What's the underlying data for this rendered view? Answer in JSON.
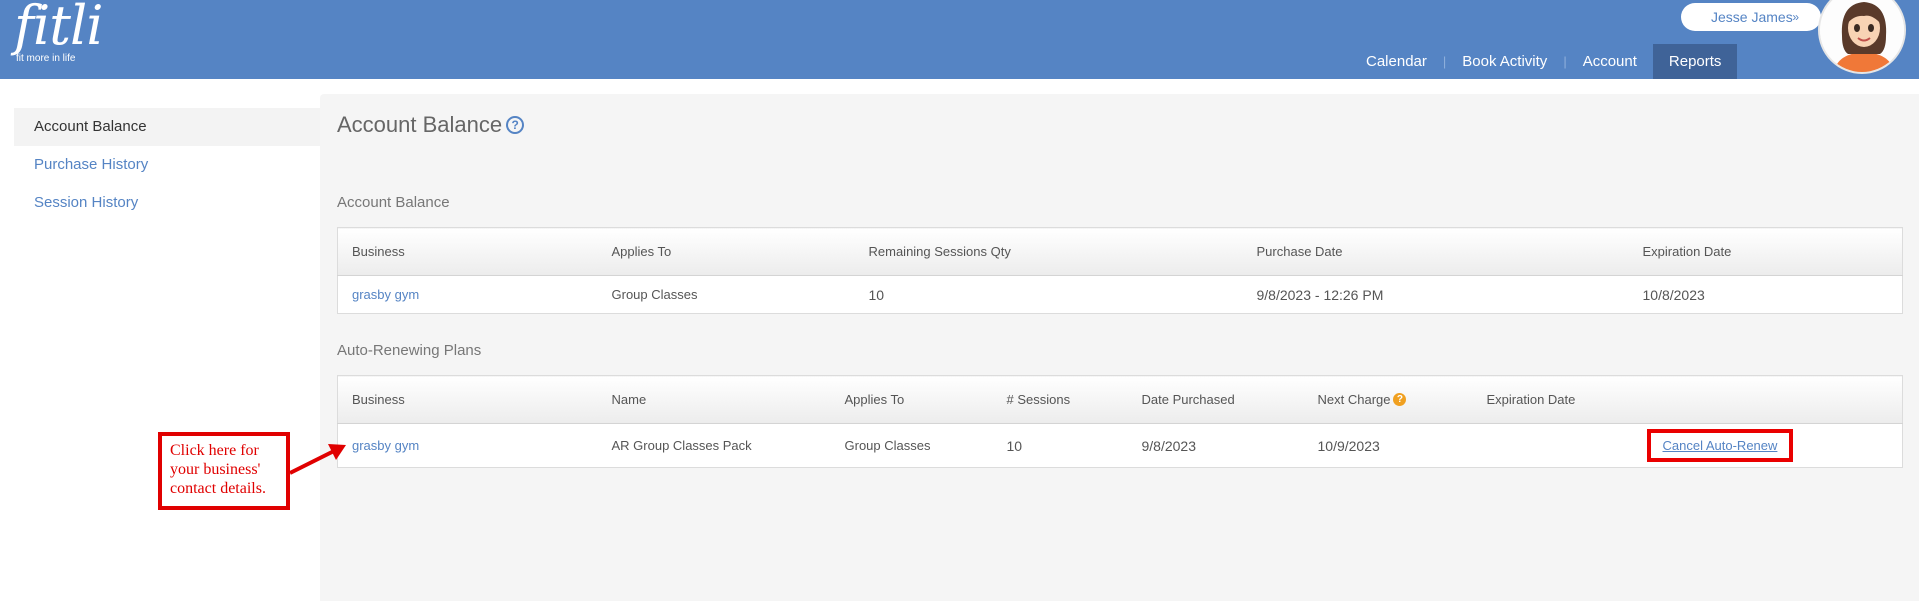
{
  "header": {
    "logo": "fitli",
    "tagline": "fit more in life",
    "user_name": "Jesse James",
    "user_chevron": "»",
    "nav": [
      {
        "label": "Calendar",
        "active": false
      },
      {
        "label": "Book Activity",
        "active": false
      },
      {
        "label": "Account",
        "active": false
      },
      {
        "label": "Reports",
        "active": true
      }
    ]
  },
  "sidebar": {
    "items": [
      {
        "label": "Account Balance",
        "active": true
      },
      {
        "label": "Purchase History",
        "active": false
      },
      {
        "label": "Session History",
        "active": false
      }
    ]
  },
  "main": {
    "title": "Account Balance",
    "help_glyph": "?",
    "balance_section": {
      "label": "Account Balance",
      "headers": [
        "Business",
        "Applies To",
        "Remaining Sessions Qty",
        "Purchase Date",
        "Expiration Date"
      ],
      "rows": [
        {
          "business": "grasby gym",
          "applies_to": "Group Classes",
          "remaining": "10",
          "purchase_date": "9/8/2023 - 12:26 PM",
          "expiration": "10/8/2023"
        }
      ]
    },
    "auto_renew_section": {
      "label": "Auto-Renewing Plans",
      "headers": [
        "Business",
        "Name",
        "Applies To",
        "# Sessions",
        "Date Purchased",
        "Next Charge",
        "Expiration Date"
      ],
      "next_charge_glyph": "?",
      "rows": [
        {
          "business": "grasby gym",
          "name": "AR Group Classes Pack",
          "applies_to": "Group Classes",
          "sessions": "10",
          "date_purchased": "9/8/2023",
          "next_charge": "10/9/2023",
          "expiration": "",
          "action": "Cancel Auto-Renew"
        }
      ]
    }
  },
  "annotation": {
    "callout_lines": [
      "Click here for",
      "your business'",
      "contact details."
    ],
    "color": "#e00000"
  },
  "colors": {
    "header_bg": "#5584c4",
    "nav_active_bg": "#3f6398",
    "link": "#5584c4",
    "highlight_box": "#ea0000"
  }
}
